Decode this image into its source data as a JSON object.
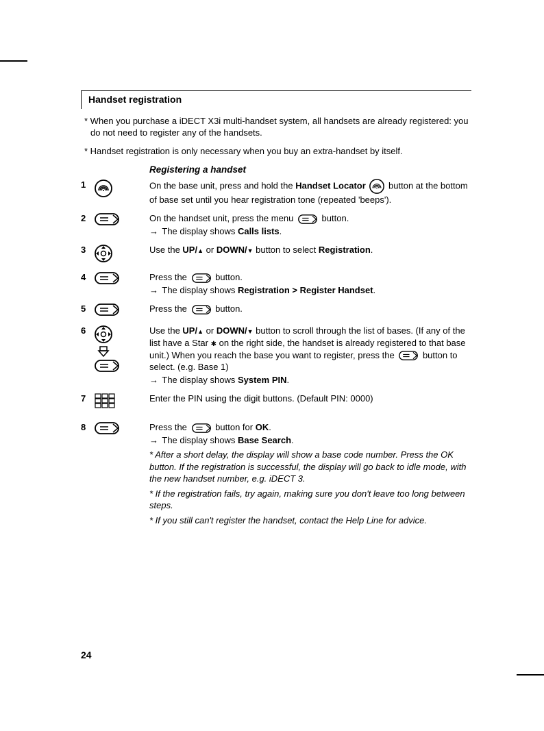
{
  "page_number": "24",
  "header": "Handset registration",
  "intro_notes": [
    "* When you purchase a iDECT X3i multi-handset system, all handsets are already registered: you do not need to register any of the handsets.",
    "* Handset registration is only necessary when you buy an extra-handset by itself."
  ],
  "section_title": "Registering a handset",
  "steps": {
    "s1": {
      "num": "1",
      "text_a": "On the base unit, press and hold the ",
      "bold_a": "Handset Locator",
      "text_b": " button at the bottom of base set until you hear registration tone (repeated 'beeps')."
    },
    "s2": {
      "num": "2",
      "text_a": "On the handset unit, press the menu ",
      "text_b": " button.",
      "result_a": "The display shows ",
      "result_bold": "Calls lists",
      "result_b": "."
    },
    "s3": {
      "num": "3",
      "text_a": "Use the ",
      "bold_a": "UP/",
      "text_b": " or ",
      "bold_b": "DOWN/",
      "text_c": " button to select ",
      "bold_c": "Registration",
      "text_d": "."
    },
    "s4": {
      "num": "4",
      "text_a": "Press the ",
      "text_b": " button.",
      "result_a": "The display shows ",
      "result_bold": "Registration > Register Handset",
      "result_b": "."
    },
    "s5": {
      "num": "5",
      "text_a": "Press the ",
      "text_b": " button."
    },
    "s6": {
      "num": "6",
      "text_a": "Use the ",
      "bold_a": "UP/",
      "text_b": " or ",
      "bold_b": "DOWN/",
      "text_c": " button to scroll through the list of bases. (If any of the list have a Star ",
      "text_d": " on the right side, the handset is already registered to that base unit.) When you reach the base you want to register, press the ",
      "text_e": " button to select. (e.g. Base 1)",
      "result_a": "The display shows ",
      "result_bold": "System PIN",
      "result_b": "."
    },
    "s7": {
      "num": "7",
      "text": "Enter the PIN using the digit buttons. (Default PIN: 0000)"
    },
    "s8": {
      "num": "8",
      "text_a": "Press the ",
      "text_b": " button for ",
      "bold_a": "OK",
      "text_c": ".",
      "result_a": "The display shows ",
      "result_bold": "Base Search",
      "result_b": ".",
      "note1": "* After a short delay, the display will show a base code number. Press the OK button. If the registration is successful, the display will go back to idle mode, with the new handset number, e.g. iDECT 3.",
      "note2": "* If the registration fails, try again, making sure you don't leave too long between steps.",
      "note3": "* If you still can't register the handset, contact the Help Line for advice."
    }
  }
}
